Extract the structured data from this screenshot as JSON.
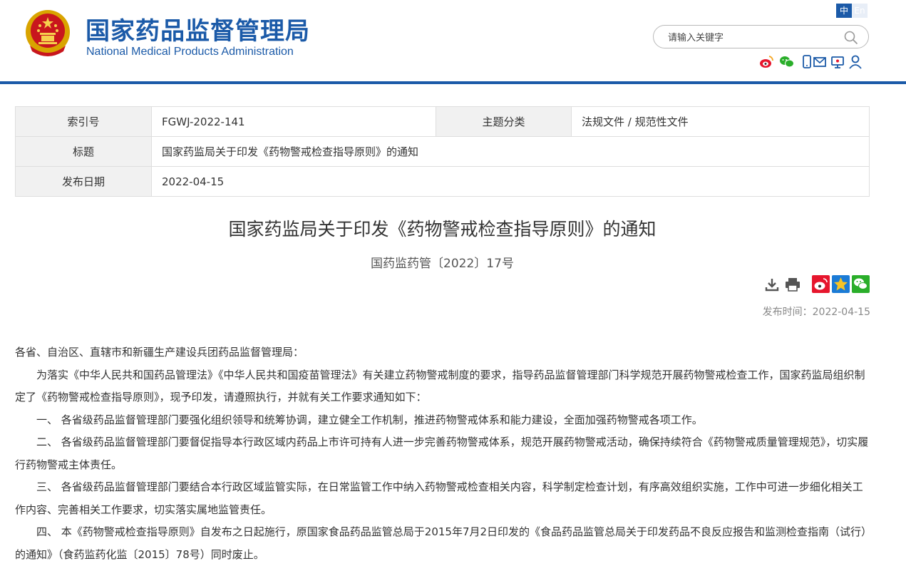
{
  "header": {
    "brand_cn": "国家药品监督管理局",
    "brand_en": "National Medical Products Administration",
    "lang_cn": "中",
    "lang_en": "En",
    "search_placeholder": "请输入关键字",
    "tool_icons": [
      "weibo-icon",
      "wechat-icon",
      "mobile-icon",
      "mail-icon",
      "monitor-icon",
      "user-icon"
    ]
  },
  "meta": {
    "index_label": "索引号",
    "index_value": "FGWJ-2022-141",
    "category_label": "主题分类",
    "category_value": "法规文件 / 规范性文件",
    "title_label": "标题",
    "title_value": "国家药监局关于印发《药物警戒检查指导原则》的通知",
    "date_label": "发布日期",
    "date_value": "2022-04-15"
  },
  "article": {
    "title": "国家药监局关于印发《药物警戒检查指导原则》的通知",
    "doc_number": "国药监药管〔2022〕17号",
    "pubtime_label": "发布时间：",
    "pubtime_value": "2022-04-15",
    "action_icons": [
      "download-icon",
      "print-icon",
      "share-weibo-icon",
      "share-qzone-icon",
      "share-wechat-icon"
    ],
    "paragraphs": [
      "各省、自治区、直辖市和新疆生产建设兵团药品监督管理局：",
      "为落实《中华人民共和国药品管理法》《中华人民共和国疫苗管理法》有关建立药物警戒制度的要求，指导药品监督管理部门科学规范开展药物警戒检查工作，国家药监局组织制定了《药物警戒检查指导原则》，现予印发，请遵照执行，并就有关工作要求通知如下：",
      "一、 各省级药品监督管理部门要强化组织领导和统筹协调，建立健全工作机制，推进药物警戒体系和能力建设，全面加强药物警戒各项工作。",
      "二、 各省级药品监督管理部门要督促指导本行政区域内药品上市许可持有人进一步完善药物警戒体系，规范开展药物警戒活动，确保持续符合《药物警戒质量管理规范》，切实履行药物警戒主体责任。",
      "三、 各省级药品监督管理部门要结合本行政区域监管实际，在日常监管工作中纳入药物警戒检查相关内容，科学制定检查计划，有序高效组织实施，工作中可进一步细化相关工作内容、完善相关工作要求，切实落实属地监管责任。",
      "四、 本《药物警戒检查指导原则》自发布之日起施行，原国家食品药品监管总局于2015年7月2日印发的《食品药品监管总局关于印发药品不良反应报告和监测检查指南（试行）的通知》（食药监药化监〔2015〕78号）同时废止。"
    ]
  }
}
